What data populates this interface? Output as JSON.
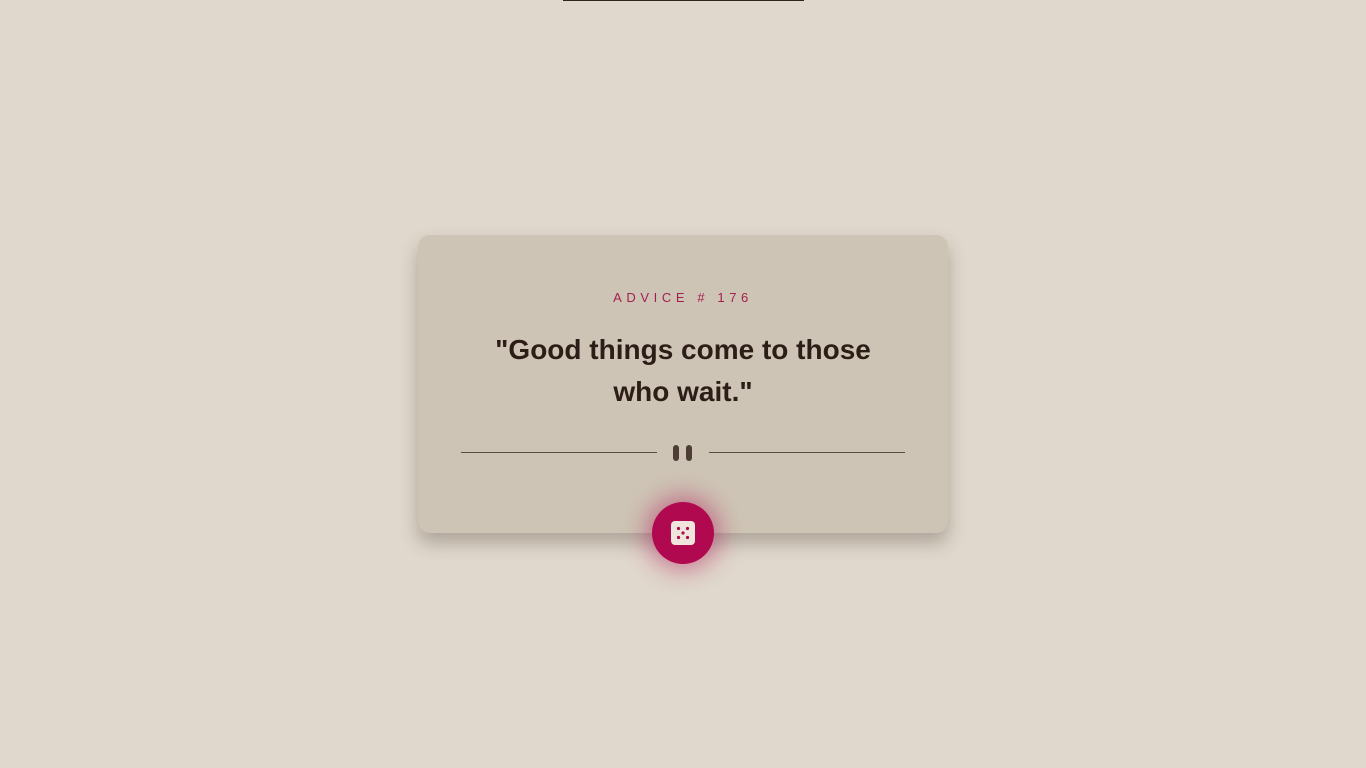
{
  "advice": {
    "label": "ADVICE # 176",
    "quote": "\"Good things come to those who wait.\""
  },
  "icons": {
    "divider": "pause-icon",
    "generate": "dice-icon"
  },
  "colors": {
    "background": "#e0d8cc",
    "card": "#cec4b5",
    "accent": "#b0094f",
    "text": "#2c1e16"
  }
}
